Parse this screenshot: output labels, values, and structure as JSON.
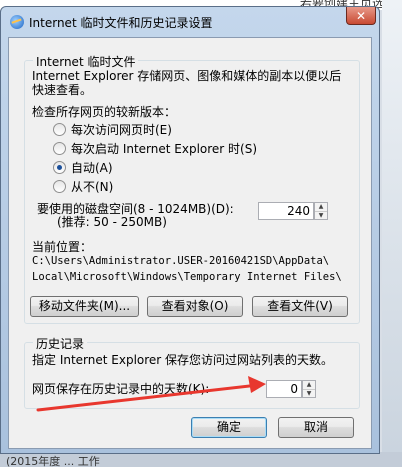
{
  "background": {
    "top_text": "若要创建主页选项卡，请在各地址行输入地址(R)：",
    "bottom_text": "(2015年度 ...                    工作"
  },
  "window": {
    "title": "Internet 临时文件和历史记录设置",
    "close_label": "✕"
  },
  "temp_files": {
    "group_title": "Internet 临时文件",
    "description_line1": "Internet Explorer 存储网页、图像和媒体的副本以便以后",
    "description_line2": "快速查看。",
    "check_label": "检查所存网页的较新版本：",
    "options": [
      {
        "label": "每次访问网页时(E)",
        "checked": false
      },
      {
        "label": "每次启动 Internet Explorer 时(S)",
        "checked": false
      },
      {
        "label": "自动(A)",
        "checked": true
      },
      {
        "label": "从不(N)",
        "checked": false
      }
    ],
    "disk_space_label": "要使用的磁盘空间(8 - 1024MB)(D):",
    "disk_space_hint": "(推荐: 50 - 250MB)",
    "disk_space_value": "240",
    "location_label": "当前位置：",
    "location_line1": "C:\\Users\\Administrator.USER-20160421SD\\AppData\\",
    "location_line2": "Local\\Microsoft\\Windows\\Temporary Internet Files\\",
    "buttons": {
      "move_folder": "移动文件夹(M)...",
      "view_objects": "查看对象(O)",
      "view_files": "查看文件(V)"
    }
  },
  "history": {
    "group_title": "历史记录",
    "description": "指定 Internet Explorer 保存您访问过网站列表的天数。",
    "days_label": "网页保存在历史记录中的天数(K):",
    "days_value": "0"
  },
  "footer": {
    "ok": "确定",
    "cancel": "取消"
  },
  "colors": {
    "arrow": "#e8372e",
    "title_bar": "#b9cfe8"
  }
}
